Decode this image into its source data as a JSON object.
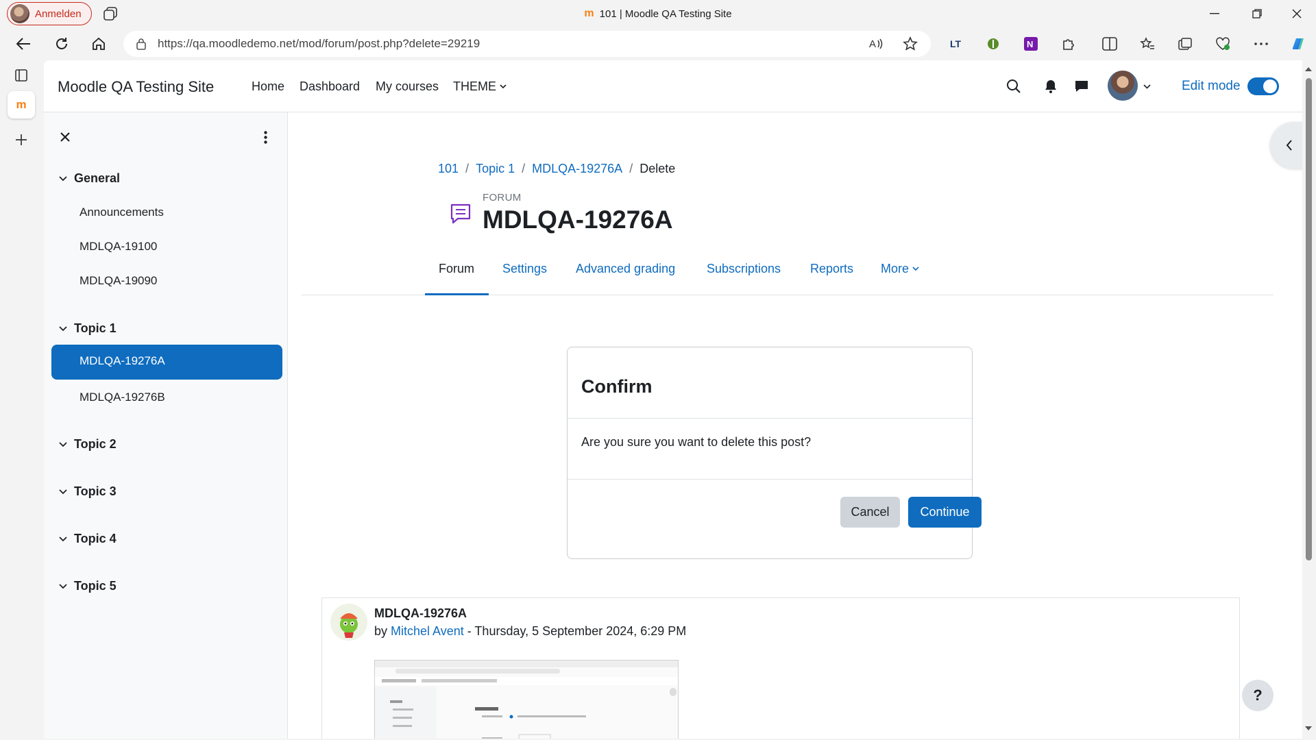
{
  "browser": {
    "profile_label": "Anmelden",
    "window_title": "101 | Moodle QA Testing Site",
    "url": "https://qa.moodledemo.net/mod/forum/post.php?delete=29219"
  },
  "navbar": {
    "site_name": "Moodle QA Testing Site",
    "links": [
      "Home",
      "Dashboard",
      "My courses",
      "THEME"
    ],
    "edit_mode_label": "Edit mode",
    "edit_mode_on": true
  },
  "course_index": {
    "sections": [
      {
        "title": "General",
        "items": [
          "Announcements",
          "MDLQA-19100",
          "MDLQA-19090"
        ]
      },
      {
        "title": "Topic 1",
        "items": [
          "MDLQA-19276A",
          "MDLQA-19276B"
        ]
      },
      {
        "title": "Topic 2",
        "items": []
      },
      {
        "title": "Topic 3",
        "items": []
      },
      {
        "title": "Topic 4",
        "items": []
      },
      {
        "title": "Topic 5",
        "items": []
      }
    ],
    "active_item": "MDLQA-19276A"
  },
  "breadcrumb": [
    "101",
    "Topic 1",
    "MDLQA-19276A",
    "Delete"
  ],
  "activity": {
    "type_label": "FORUM",
    "title": "MDLQA-19276A"
  },
  "secondary_nav": {
    "tabs": [
      "Forum",
      "Settings",
      "Advanced grading",
      "Subscriptions",
      "Reports",
      "More"
    ],
    "active": "Forum"
  },
  "confirm_dialog": {
    "title": "Confirm",
    "message": "Are you sure you want to delete this post?",
    "cancel_label": "Cancel",
    "continue_label": "Continue"
  },
  "post": {
    "subject": "MDLQA-19276A",
    "by_label": "by",
    "author": "Mitchel Avent",
    "date": " - Thursday, 5 September 2024, 6:29 PM"
  },
  "help_label": "?",
  "colors": {
    "primary": "#0f6cbf",
    "text": "#1d2125",
    "drawer_bg": "#f8f9fa",
    "forum_icon": "#7b2fbe"
  }
}
